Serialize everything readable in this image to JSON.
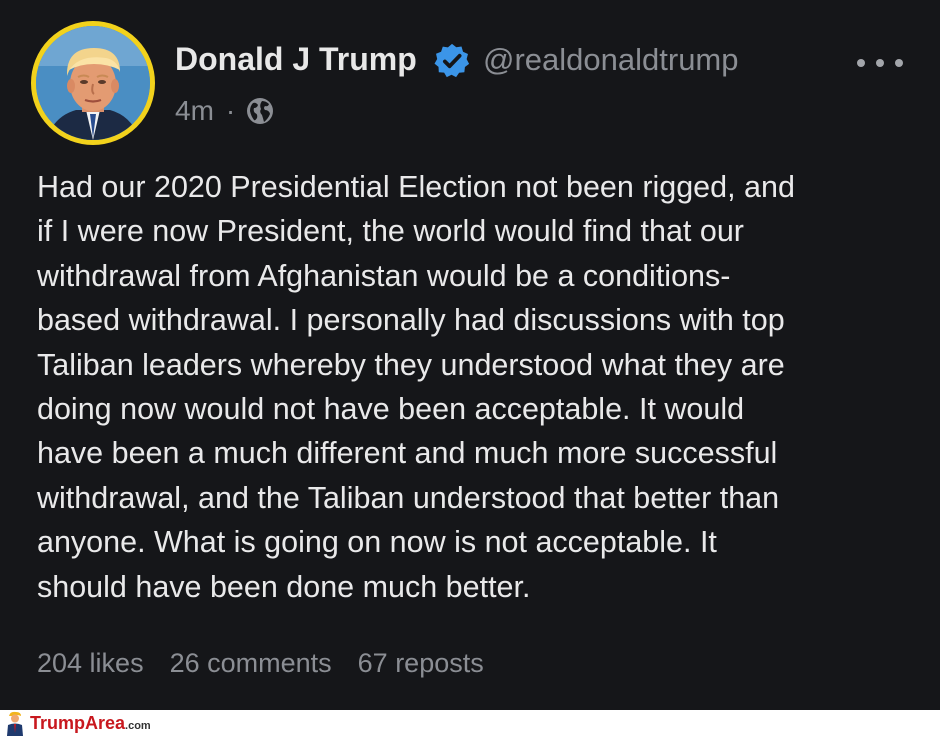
{
  "post": {
    "author": {
      "display_name": "Donald J Trump",
      "handle": "@realdonaldtrump",
      "avatar_icon": "profile-photo",
      "verified_icon": "verified-badge-icon",
      "verified_color": "#3b95e8",
      "avatar_ring_color": "#f2d21c"
    },
    "meta": {
      "time": "4m",
      "separator": "·",
      "visibility_icon": "globe-icon"
    },
    "more_icon": "more-horizontal-icon",
    "body_lines": [
      "Had our 2020 Presidential Election not been rigged, and",
      "if I were now President, the world would find that our",
      "withdrawal from Afghanistan would be a conditions-",
      "based withdrawal. I personally had discussions with top",
      "Taliban leaders whereby they understood what they are",
      "doing now would not have been acceptable. It would",
      "have been a much different and much more successful",
      "withdrawal, and the Taliban understood that better than",
      "anyone. What is going on now is not acceptable. It",
      "should have been done much better."
    ],
    "stats": {
      "likes": "204 likes",
      "comments": "26 comments",
      "reposts": "67 reposts"
    }
  },
  "watermark": {
    "text": "TrumpArea",
    "suffix": ".com",
    "color": "#c8181e"
  },
  "colors": {
    "background": "#151619",
    "text": "#e9e9ea",
    "muted": "#8b8e94"
  }
}
